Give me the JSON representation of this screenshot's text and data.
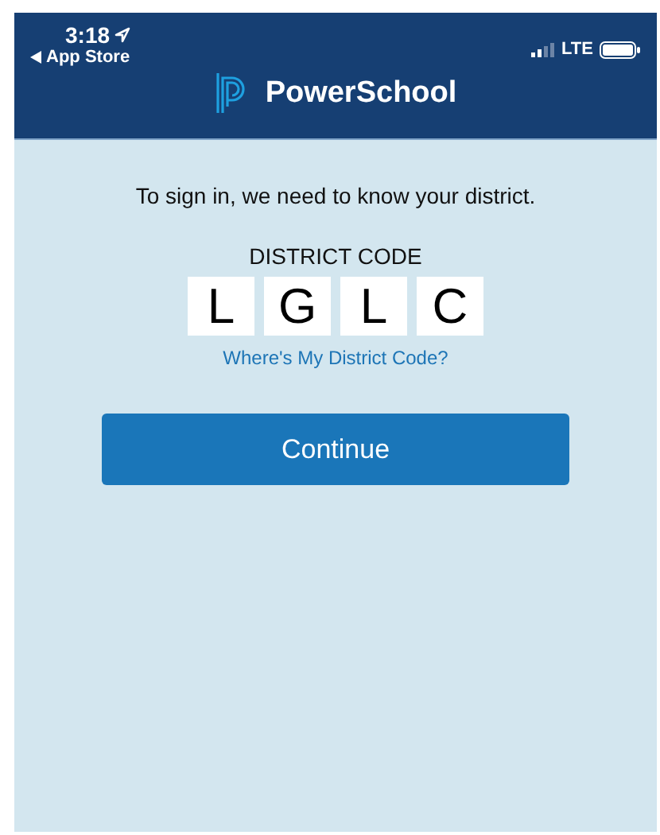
{
  "status_bar": {
    "time": "3:18",
    "back_label": "App Store",
    "network": "LTE"
  },
  "header": {
    "title": "PowerSchool"
  },
  "signin": {
    "prompt": "To sign in, we need to know your district.",
    "code_label": "DISTRICT CODE",
    "code": [
      "L",
      "G",
      "L",
      "C"
    ],
    "help_link": "Where's My District Code?",
    "continue_button": "Continue"
  }
}
